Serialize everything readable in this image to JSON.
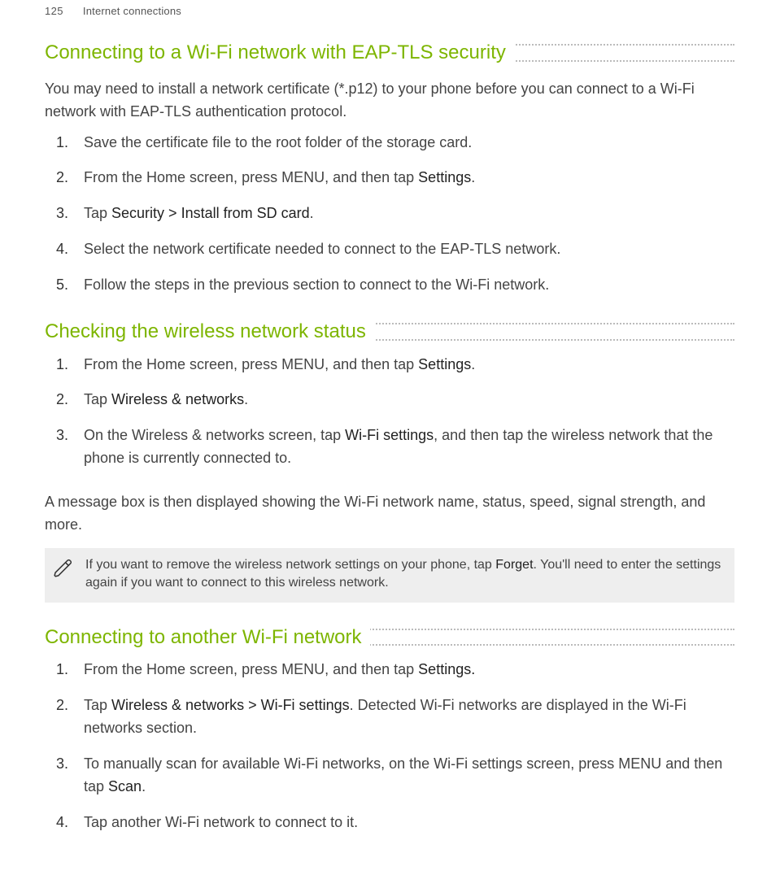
{
  "header": {
    "page": "125",
    "section": "Internet connections"
  },
  "sec1": {
    "title": "Connecting to a Wi-Fi network with EAP-TLS security",
    "intro": "You may need to install a network certificate (*.p12) to your phone before you can connect to a Wi-Fi network with EAP-TLS authentication protocol.",
    "steps": {
      "s1": "Save the certificate file to the root folder of the storage card.",
      "s2a": "From the Home screen, press MENU, and then tap ",
      "s2b": "Settings",
      "s2c": ".",
      "s3a": "Tap ",
      "s3b": "Security > Install from SD card",
      "s3c": ".",
      "s4": "Select the network certificate needed to connect to the EAP-TLS network.",
      "s5": "Follow the steps in the previous section to connect to the Wi-Fi network."
    }
  },
  "sec2": {
    "title": "Checking the wireless network status",
    "steps": {
      "s1a": "From the Home screen, press MENU, and then tap ",
      "s1b": "Settings",
      "s1c": ".",
      "s2a": "Tap ",
      "s2b": "Wireless & networks",
      "s2c": ".",
      "s3a": "On the Wireless & networks screen, tap ",
      "s3b": "Wi-Fi settings",
      "s3c": ", and then tap the wireless network that the phone is currently connected to."
    },
    "after": "A message box is then displayed showing the Wi-Fi network name, status, speed, signal strength, and more.",
    "note": {
      "a": "If you want to remove the wireless network settings on your phone, tap ",
      "b": "Forget",
      "c": ". You'll need to enter the settings again if you want to connect to this wireless network."
    }
  },
  "sec3": {
    "title": "Connecting to another Wi-Fi network",
    "steps": {
      "s1a": "From the Home screen, press MENU, and then tap ",
      "s1b": "Settings.",
      "s2a": "Tap ",
      "s2b": "Wireless & networks > Wi-Fi settings",
      "s2c": ". Detected Wi-Fi networks are displayed in the Wi-Fi networks section.",
      "s3a": "To manually scan for available Wi-Fi networks, on the Wi-Fi settings screen, press MENU and then tap ",
      "s3b": "Scan",
      "s3c": ".",
      "s4": "Tap another Wi-Fi network to connect to it."
    }
  }
}
